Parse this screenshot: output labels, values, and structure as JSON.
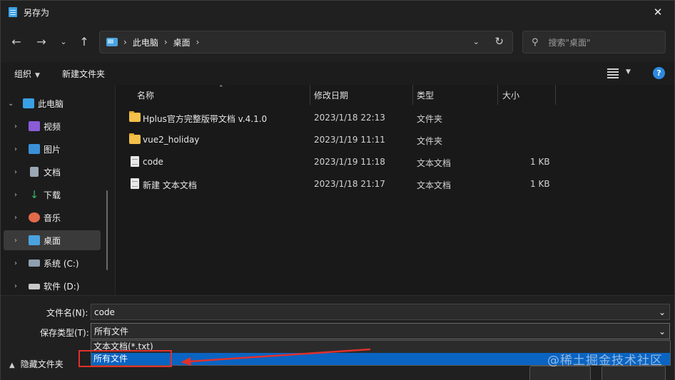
{
  "window": {
    "title": "另存为"
  },
  "nav": {
    "breadcrumbs": [
      "此电脑",
      "桌面"
    ],
    "search_placeholder": "搜索\"桌面\""
  },
  "toolbar": {
    "organize": "组织",
    "new_folder": "新建文件夹"
  },
  "sidebar": {
    "items": [
      {
        "label": "此电脑",
        "icon": "pc-icon"
      },
      {
        "label": "视频",
        "icon": "video-icon"
      },
      {
        "label": "图片",
        "icon": "picture-icon"
      },
      {
        "label": "文档",
        "icon": "document-icon"
      },
      {
        "label": "下载",
        "icon": "download-icon"
      },
      {
        "label": "音乐",
        "icon": "music-icon"
      },
      {
        "label": "桌面",
        "icon": "desktop-icon"
      },
      {
        "label": "系统 (C:)",
        "icon": "drive-icon"
      },
      {
        "label": "软件 (D:)",
        "icon": "drive-icon"
      }
    ],
    "selected": "桌面"
  },
  "file_list": {
    "columns": [
      "名称",
      "修改日期",
      "类型",
      "大小"
    ],
    "rows": [
      {
        "name": "Hplus官方完整版带文档 v.4.1.0",
        "date": "2023/1/18 22:13",
        "type": "文件夹",
        "size": "",
        "icon": "folder-icon"
      },
      {
        "name": "vue2_holiday",
        "date": "2023/1/19 11:11",
        "type": "文件夹",
        "size": "",
        "icon": "folder-icon"
      },
      {
        "name": "code",
        "date": "2023/1/19 11:18",
        "type": "文本文档",
        "size": "1 KB",
        "icon": "text-file-icon"
      },
      {
        "name": "新建 文本文档",
        "date": "2023/1/18 21:17",
        "type": "文本文档",
        "size": "1 KB",
        "icon": "text-file-icon"
      }
    ]
  },
  "form": {
    "filename_label": "文件名(N):",
    "filename_value": "code",
    "filetype_label": "保存类型(T):",
    "filetype_value": "所有文件",
    "filetype_options": [
      "文本文档(*.txt)",
      "所有文件"
    ],
    "filetype_selected_index": 1
  },
  "footer": {
    "hide_folders": "隐藏文件夹"
  },
  "watermark": "@稀土掘金技术社区",
  "colors": {
    "accent": "#0a64c2",
    "annotation": "#e0312b",
    "folder": "#f4c04a"
  }
}
